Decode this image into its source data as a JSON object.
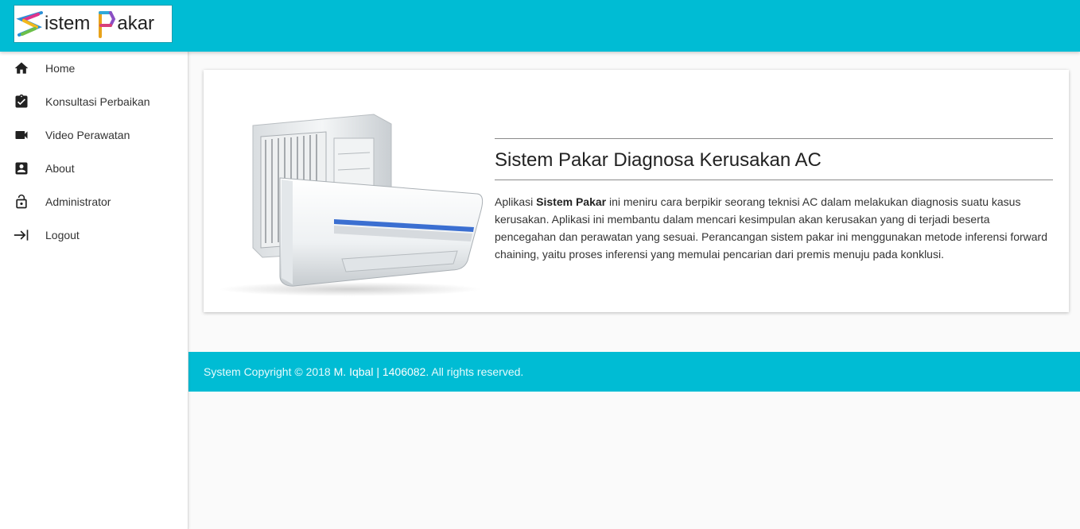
{
  "header": {
    "logo": {
      "text_left": "istem",
      "text_right": "akar"
    }
  },
  "sidebar": {
    "items": [
      {
        "label": "Home",
        "icon": "home-icon"
      },
      {
        "label": "Konsultasi Perbaikan",
        "icon": "clipboard-check-icon"
      },
      {
        "label": "Video Perawatan",
        "icon": "video-camera-icon"
      },
      {
        "label": "About",
        "icon": "account-box-icon"
      },
      {
        "label": "Administrator",
        "icon": "lock-icon"
      },
      {
        "label": "Logout",
        "icon": "logout-arrow-icon"
      }
    ]
  },
  "main": {
    "card": {
      "title": "Sistem Pakar Diagnosa Kerusakan AC",
      "desc_prefix": "Aplikasi ",
      "desc_bold": "Sistem Pakar",
      "desc_rest": " ini meniru cara berpikir seorang teknisi AC dalam melakukan diagnosis suatu kasus kerusakan. Aplikasi ini membantu dalam mencari kesimpulan akan kerusakan yang di terjadi beserta pencegahan dan perawatan yang sesuai. Perancangan sistem pakar ini menggunakan metode inferensi forward chaining, yaitu proses inferensi yang memulai pencarian dari premis menuju pada konklusi."
    }
  },
  "footer": {
    "prefix": "System Copyright © 2018 ",
    "author": "M. Iqbal | 1406082",
    "suffix": ". All rights reserved."
  },
  "colors": {
    "primary": "#00bcd4",
    "sidebar_bg": "#ffffff",
    "page_bg": "#fafafa"
  }
}
